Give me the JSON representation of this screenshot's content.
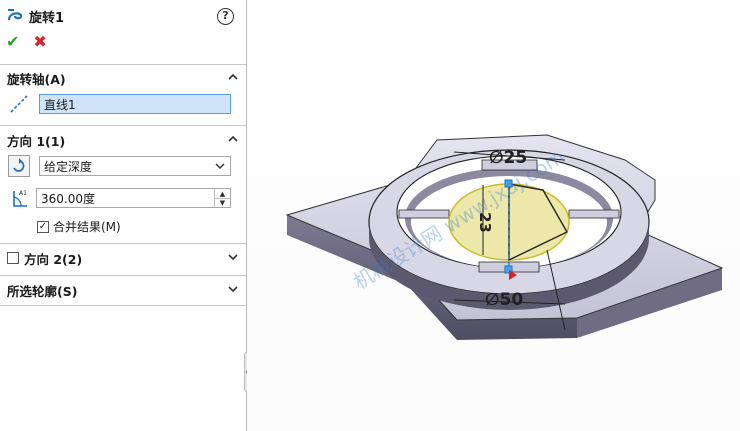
{
  "feature": {
    "title": "旋转1"
  },
  "actions": {
    "ok": "✔",
    "cancel": "✖"
  },
  "axis_section": {
    "title": "旋转轴(A)",
    "axis_value": "直线1"
  },
  "direction1": {
    "title": "方向 1(1)",
    "end_condition": "给定深度",
    "angle_icon_label": "A1",
    "angle_value": "360.00度",
    "merge_label": "合并结果(M)",
    "merge_checked": true
  },
  "direction2": {
    "title": "方向 2(2)",
    "checked": false
  },
  "contours": {
    "title": "所选轮廓(S)"
  },
  "model": {
    "dim_top": "∅25",
    "dim_vertical": "23",
    "dim_bottom": "∅50",
    "watermark": "机械设计网 www.jxaj.com"
  },
  "colors": {
    "accent_blue": "#1f6fbf",
    "selection": "#cfe4f8",
    "ok": "#2ea12e",
    "cancel": "#d3242c",
    "part": "#c7c6d8",
    "preview": "#eae49a"
  }
}
